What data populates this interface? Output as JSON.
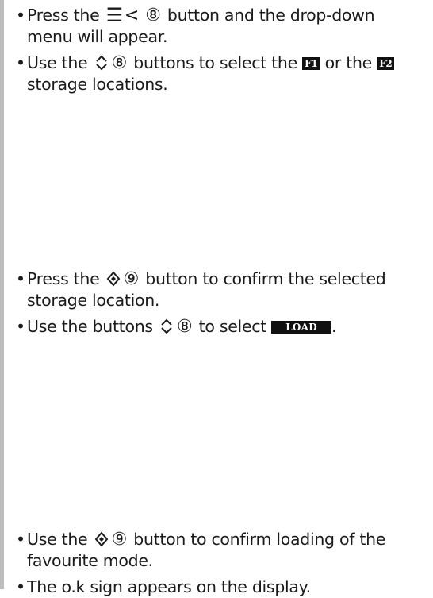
{
  "bullet": "•",
  "icons": {
    "menu": "☰",
    "back": "<",
    "num8": "⑧",
    "num9": "⑨"
  },
  "steps": [
    {
      "pre": "Press the",
      "post": "button and the drop-down",
      "cont": "menu will appear."
    },
    {
      "pre": "Use the",
      "mid": "buttons to select the",
      "or": "or the",
      "cont": "storage locations."
    },
    {
      "pre": "Press the",
      "post": "button to confirm the selected",
      "cont": "storage location."
    },
    {
      "pre": "Use the buttons",
      "post": "to select",
      "end": "."
    },
    {
      "pre": "Use the",
      "post": "button to confirm loading of the",
      "cont": "favourite mode."
    },
    {
      "text": "The o.k sign appears on the display."
    }
  ],
  "badges": {
    "f1": "F1",
    "f2": "F2",
    "load": "LOAD"
  }
}
